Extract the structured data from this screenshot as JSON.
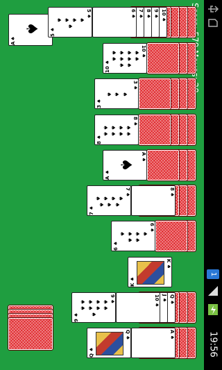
{
  "status_bar": {
    "time": "19:56",
    "icons": [
      "usb-icon",
      "sd-card-icon",
      "app-notification-icon",
      "signal-icon",
      "battery-charging-icon"
    ],
    "notification_badge": "1"
  },
  "game": {
    "score_text": "Score: 579  Moves: 20",
    "foundation": {
      "rank": "A",
      "suit": "♠"
    },
    "stock": {
      "cards": 4
    },
    "suit_symbol": "♠",
    "columns": [
      {
        "face_down": 5,
        "face_up": [
          "10",
          "9",
          "8",
          "7",
          "6",
          "5"
        ],
        "top": "10"
      },
      {
        "face_down": 3,
        "face_up": [
          "10"
        ],
        "top": "10"
      },
      {
        "face_down": 4,
        "face_up": [
          "3"
        ],
        "top": "3"
      },
      {
        "face_down": 4,
        "face_up": [
          "8"
        ],
        "top": "8"
      },
      {
        "face_down": 3,
        "face_up": [
          "A"
        ],
        "top": "A"
      },
      {
        "face_down": 4,
        "face_up": [
          "8",
          "7"
        ],
        "top": "7"
      },
      {
        "face_down": 2,
        "face_up": [
          "6"
        ],
        "top": "6"
      },
      {
        "face_down": 0,
        "face_up": [
          "K"
        ],
        "top": "K"
      },
      {
        "face_down": 4,
        "face_up": [
          "Q",
          "J",
          "10",
          "9"
        ],
        "top": "9"
      },
      {
        "face_down": 4,
        "face_up": [
          "A",
          "Q"
        ],
        "top": "Q"
      }
    ]
  }
}
